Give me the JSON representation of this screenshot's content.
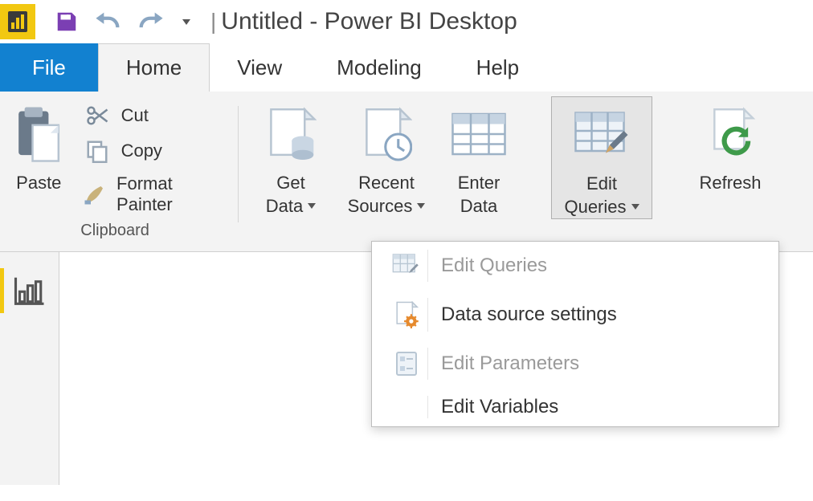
{
  "title": "Untitled - Power BI Desktop",
  "qat": {
    "save_title": "Save",
    "undo_title": "Undo",
    "redo_title": "Redo",
    "customize_title": "Customize Quick Access Toolbar"
  },
  "tabs": {
    "file": "File",
    "home": "Home",
    "view": "View",
    "modeling": "Modeling",
    "help": "Help",
    "active": "Home"
  },
  "ribbon": {
    "clipboard": {
      "group_label": "Clipboard",
      "paste": "Paste",
      "cut": "Cut",
      "copy": "Copy",
      "format_painter": "Format Painter"
    },
    "external_data": {
      "get_data_line1": "Get",
      "get_data_line2": "Data",
      "recent_line1": "Recent",
      "recent_line2": "Sources",
      "enter_line1": "Enter",
      "enter_line2": "Data",
      "edit_queries_line1": "Edit",
      "edit_queries_line2": "Queries",
      "refresh": "Refresh"
    }
  },
  "menu": {
    "edit_queries": "Edit Queries",
    "data_source_settings": "Data source settings",
    "edit_parameters": "Edit Parameters",
    "edit_variables": "Edit Variables"
  },
  "nav": {
    "report": "Report view"
  },
  "colors": {
    "brand_yellow": "#f2c811",
    "file_blue": "#1281d0",
    "icon_blue": "#5a7ea8",
    "refresh_green": "#3e9a4a",
    "gear_orange": "#e68a2e"
  }
}
